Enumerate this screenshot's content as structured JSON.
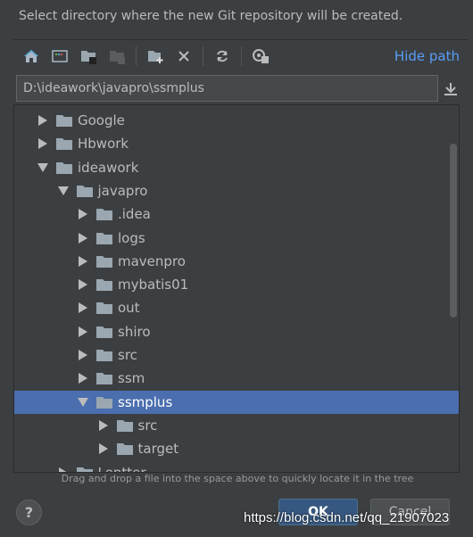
{
  "title": "Select directory where the new Git repository will be created.",
  "toolbar": {
    "icons": [
      "home-icon",
      "desktop-icon",
      "project-folder-icon",
      "module-folder-icon",
      "new-folder-icon",
      "delete-icon",
      "refresh-icon",
      "show-hidden-icon"
    ],
    "hide_path": "Hide path"
  },
  "path_value": "D:\\ideawork\\javapro\\ssmplus",
  "tree": [
    {
      "label": "Google",
      "level": 0,
      "expanded": false
    },
    {
      "label": "Hbwork",
      "level": 0,
      "expanded": false
    },
    {
      "label": "ideawork",
      "level": 0,
      "expanded": true
    },
    {
      "label": "javapro",
      "level": 1,
      "expanded": true
    },
    {
      "label": ".idea",
      "level": 2,
      "expanded": false
    },
    {
      "label": "logs",
      "level": 2,
      "expanded": false
    },
    {
      "label": "mavenpro",
      "level": 2,
      "expanded": false
    },
    {
      "label": "mybatis01",
      "level": 2,
      "expanded": false
    },
    {
      "label": "out",
      "level": 2,
      "expanded": false
    },
    {
      "label": "shiro",
      "level": 2,
      "expanded": false
    },
    {
      "label": "src",
      "level": 2,
      "expanded": false
    },
    {
      "label": "ssm",
      "level": 2,
      "expanded": false
    },
    {
      "label": "ssmplus",
      "level": 2,
      "expanded": true,
      "selected": true
    },
    {
      "label": "src",
      "level": 3,
      "expanded": false
    },
    {
      "label": "target",
      "level": 3,
      "expanded": false
    },
    {
      "label": "Lentter",
      "level": 1,
      "expanded": false
    }
  ],
  "hint": "Drag and drop a file into the space above to quickly locate it in the tree",
  "help": "?",
  "ok": "OK",
  "cancel": "Cancel",
  "watermark": "https://blog.csdn.net/qq_21907023",
  "colors": {
    "background": "#3c3f41",
    "selection": "#4b6eaf",
    "link": "#589df6",
    "ok_button": "#365880"
  }
}
